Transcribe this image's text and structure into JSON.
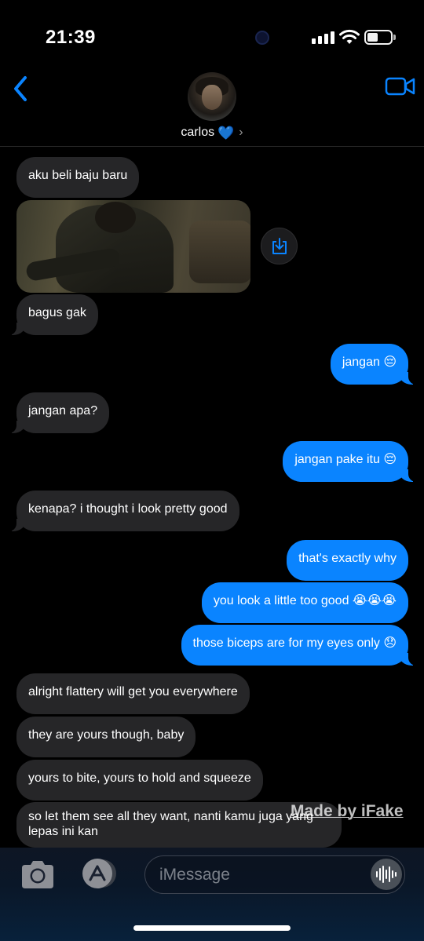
{
  "status_bar": {
    "time": "21:39"
  },
  "header": {
    "contact_name": "carlos",
    "contact_emoji": "💙",
    "chevron": "›",
    "icons": {
      "back": "chevron-left-icon",
      "video": "video-camera-icon"
    },
    "accent_color": "#0a84ff"
  },
  "messages": [
    {
      "side": "in",
      "text": "aku beli baju baru"
    },
    {
      "side": "in",
      "type": "image"
    },
    {
      "side": "in",
      "text": "bagus gak"
    },
    {
      "side": "out",
      "text": "jangan 😔"
    },
    {
      "side": "in",
      "text": "jangan apa?"
    },
    {
      "side": "out",
      "text": "jangan pake itu 😔"
    },
    {
      "side": "in",
      "text": "kenapa? i thought i look pretty good"
    },
    {
      "side": "out",
      "text": "that's exactly why"
    },
    {
      "side": "out",
      "text": "you look a little too good 😭😭😭"
    },
    {
      "side": "out",
      "text": "those biceps are for my eyes only 😞"
    },
    {
      "side": "in",
      "text": "alright flattery will get you everywhere"
    },
    {
      "side": "in",
      "text": "they are yours though, baby"
    },
    {
      "side": "in",
      "text": "yours to bite, yours to hold and squeeze"
    },
    {
      "side": "in",
      "text": "so let them see all they want, nanti kamu juga yang lepas ini kan"
    }
  ],
  "watermark": "Made by iFake",
  "compose": {
    "placeholder": "iMessage",
    "icons": {
      "camera": "camera-icon",
      "apps": "app-store-icon",
      "audio": "waveform-icon",
      "save": "save-download-icon"
    }
  },
  "colors": {
    "incoming_bubble": "#262628",
    "outgoing_bubble": "#0a84ff",
    "background": "#000000"
  }
}
